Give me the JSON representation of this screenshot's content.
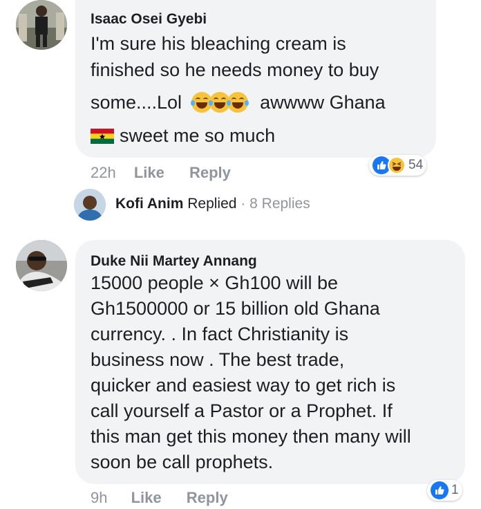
{
  "comments": [
    {
      "author": "Isaac Osei Gyebi",
      "text_line1": "I'm sure his bleaching cream is",
      "text_line2": "finished so he needs money to buy",
      "text_line3_before": "some....Lol",
      "text_line3_after": "awwww Ghana",
      "text_line4": "sweet me so much",
      "emojis": [
        "tears-of-joy-emoji-icon",
        "tears-of-joy-emoji-icon",
        "tears-of-joy-emoji-icon"
      ],
      "flag": "ghana-flag-icon",
      "time": "22h",
      "like_label": "Like",
      "reply_label": "Reply",
      "reaction_count": "54",
      "reactions": [
        "like-reaction-icon",
        "haha-reaction-icon"
      ]
    },
    {
      "author": "Duke Nii Martey Annang",
      "lines": [
        "15000 people × Gh100 will be",
        "Gh1500000 or 15 billion old Ghana",
        "currency. . In fact Christianity is",
        "business now .  The best trade,",
        "quicker and easiest way to get rich is",
        "call yourself a Pastor or a Prophet. If",
        "this man get this money then many will",
        "soon be call prophets."
      ],
      "time": "9h",
      "like_label": "Like",
      "reply_label": "Reply",
      "reaction_count": "1",
      "reactions": [
        "like-reaction-icon"
      ]
    }
  ],
  "reply_summary": {
    "author": "Kofi Anim",
    "action": "Replied",
    "separator": "·",
    "count_label": "8 Replies"
  },
  "colors": {
    "bubble": "#f2f3f5",
    "meta": "#90949c",
    "like_blue": "#1877f2",
    "haha_yellow": "#f7c33b"
  }
}
